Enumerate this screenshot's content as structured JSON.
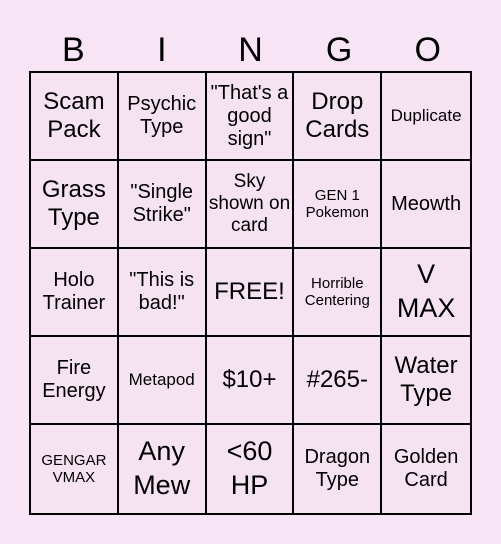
{
  "header": {
    "letters": [
      "B",
      "I",
      "N",
      "G",
      "O"
    ]
  },
  "board": {
    "rows": [
      [
        "Scam Pack",
        "Psychic Type",
        "\"That's a good sign\"",
        "Drop Cards",
        "Duplicate"
      ],
      [
        "Grass Type",
        "\"Single Strike\"",
        "Sky shown on card",
        "GEN 1 Pokemon",
        "Meowth"
      ],
      [
        "Holo Trainer",
        "\"This is bad!\"",
        "FREE!",
        "Horrible Centering",
        "V MAX"
      ],
      [
        "Fire Energy",
        "Metapod",
        "$10+",
        "#265-",
        "Water Type"
      ],
      [
        "GENGAR VMAX",
        "Any Mew",
        "<60 HP",
        "Dragon Type",
        "Golden Card"
      ]
    ]
  },
  "colors": {
    "background": "#f7e4f4",
    "cell": "#f5e3f2",
    "grid": "#000000"
  }
}
